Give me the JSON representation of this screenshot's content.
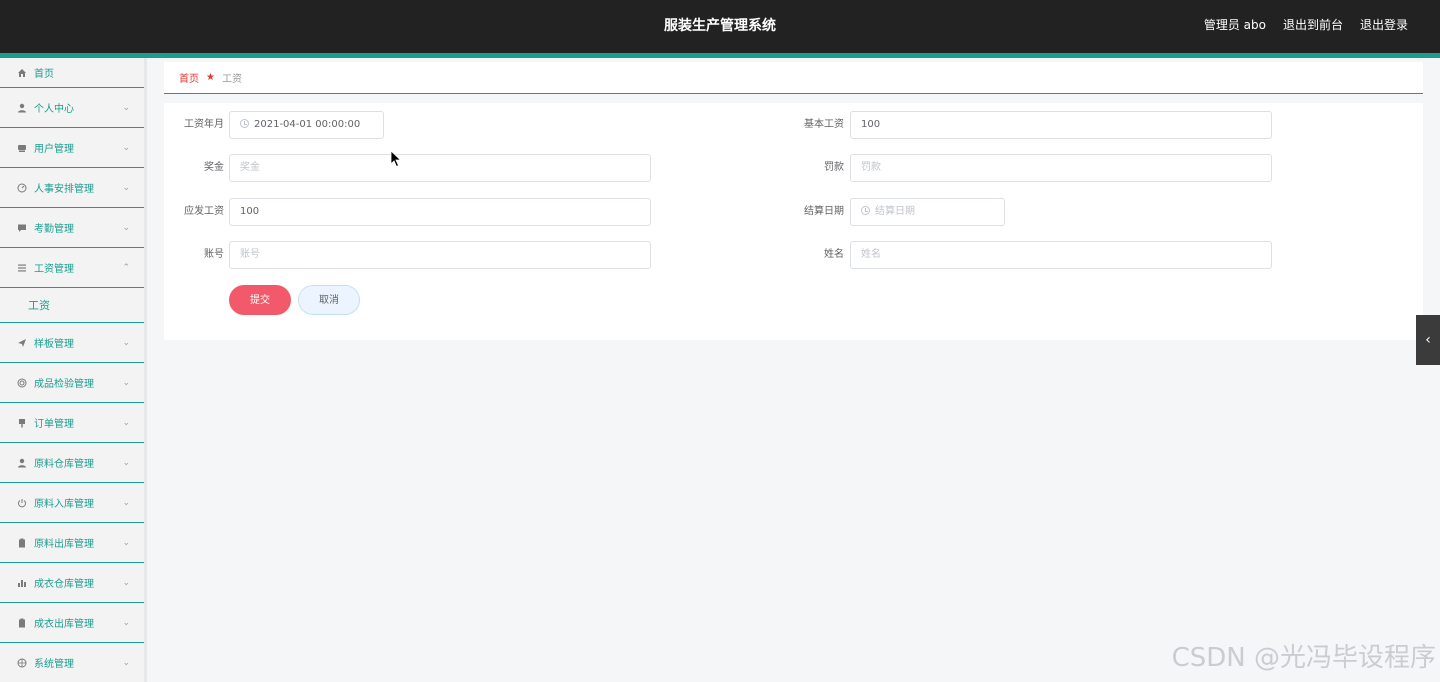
{
  "header": {
    "title": "服装生产管理系统",
    "user_label": "管理员 abo",
    "to_front_label": "退出到前台",
    "logout_label": "退出登录"
  },
  "sidebar": {
    "items": [
      {
        "label": "首页",
        "icon": "home-icon"
      },
      {
        "label": "个人中心",
        "icon": "user-icon"
      },
      {
        "label": "用户管理",
        "icon": "users-icon"
      },
      {
        "label": "人事安排管理",
        "icon": "gauge-icon"
      },
      {
        "label": "考勤管理",
        "icon": "comment-icon"
      },
      {
        "label": "工资管理",
        "icon": "list-icon",
        "expanded": true,
        "children": [
          "工资"
        ]
      },
      {
        "label": "样板管理",
        "icon": "send-icon"
      },
      {
        "label": "成品检验管理",
        "icon": "target-icon"
      },
      {
        "label": "订单管理",
        "icon": "pin-icon"
      },
      {
        "label": "原料仓库管理",
        "icon": "person-icon"
      },
      {
        "label": "原料入库管理",
        "icon": "power-icon"
      },
      {
        "label": "原料出库管理",
        "icon": "clipboard-icon"
      },
      {
        "label": "成衣仓库管理",
        "icon": "bar-chart-icon"
      },
      {
        "label": "成衣出库管理",
        "icon": "clipboard-icon"
      },
      {
        "label": "系统管理",
        "icon": "settings-icon"
      }
    ]
  },
  "breadcrumb": {
    "home": "首页",
    "current": "工资"
  },
  "form": {
    "salary_month": {
      "label": "工资年月",
      "value": "2021-04-01 00:00:00"
    },
    "base_salary": {
      "label": "基本工资",
      "value": "100"
    },
    "bonus": {
      "label": "奖金",
      "placeholder": "奖金"
    },
    "penalty": {
      "label": "罚款",
      "placeholder": "罚款"
    },
    "gross_pay": {
      "label": "应发工资",
      "value": "100"
    },
    "settle_date": {
      "label": "结算日期",
      "placeholder": "结算日期"
    },
    "account": {
      "label": "账号",
      "placeholder": "账号"
    },
    "name": {
      "label": "姓名",
      "placeholder": "姓名"
    },
    "submit_label": "提交",
    "cancel_label": "取消"
  },
  "colors": {
    "accent": "#1a9d8f",
    "submit": "#f25a6b",
    "topbar": "#222222"
  },
  "watermark": "CSDN @光冯毕设程序"
}
